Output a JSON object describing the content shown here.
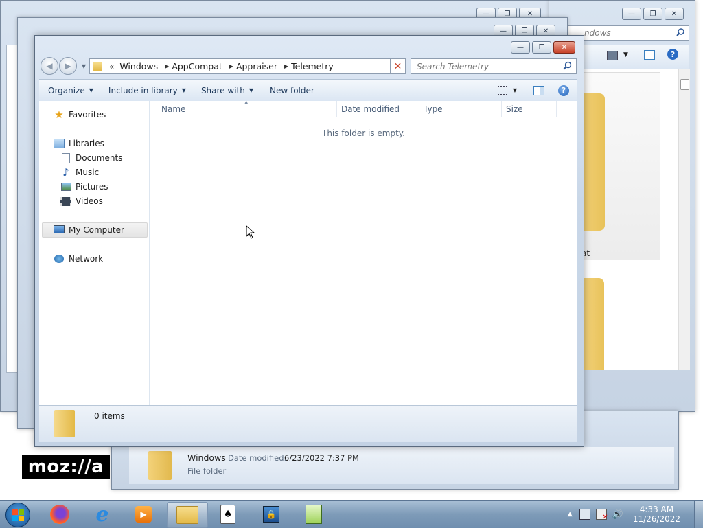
{
  "background_windows": {
    "far": {
      "search_placeholder": "ndows"
    },
    "folder_label": "at"
  },
  "main_window": {
    "address": {
      "overflow": "«",
      "crumbs": [
        "Windows",
        "AppCompat",
        "Appraiser",
        "Telemetry"
      ]
    },
    "search": {
      "placeholder": "Search Telemetry"
    },
    "toolbar": {
      "organize": "Organize",
      "include_in_library": "Include in library",
      "share_with": "Share with",
      "new_folder": "New folder"
    },
    "nav": {
      "favorites": "Favorites",
      "libraries": "Libraries",
      "documents": "Documents",
      "music": "Music",
      "pictures": "Pictures",
      "videos": "Videos",
      "my_computer": "My Computer",
      "network": "Network"
    },
    "columns": {
      "name": "Name",
      "date_modified": "Date modified",
      "type": "Type",
      "size": "Size"
    },
    "empty_message": "This folder is empty.",
    "status": {
      "items": "0 items"
    }
  },
  "behind_details": {
    "name": "Windows",
    "date_label": "Date modified:",
    "date_value": "6/23/2022 7:37 PM",
    "type": "File folder"
  },
  "watermark": "moz://a",
  "taskbar": {
    "apps": [
      "start-orb",
      "firefox",
      "internet-explorer",
      "media-player",
      "windows-explorer",
      "solitaire",
      "security-tool",
      "notepad-plus"
    ],
    "clock": {
      "time": "4:33 AM",
      "date": "11/26/2022"
    }
  },
  "colors": {
    "accent": "#2b5797",
    "close_red": "#c8432a",
    "taskbar": "#7e9bb8"
  }
}
